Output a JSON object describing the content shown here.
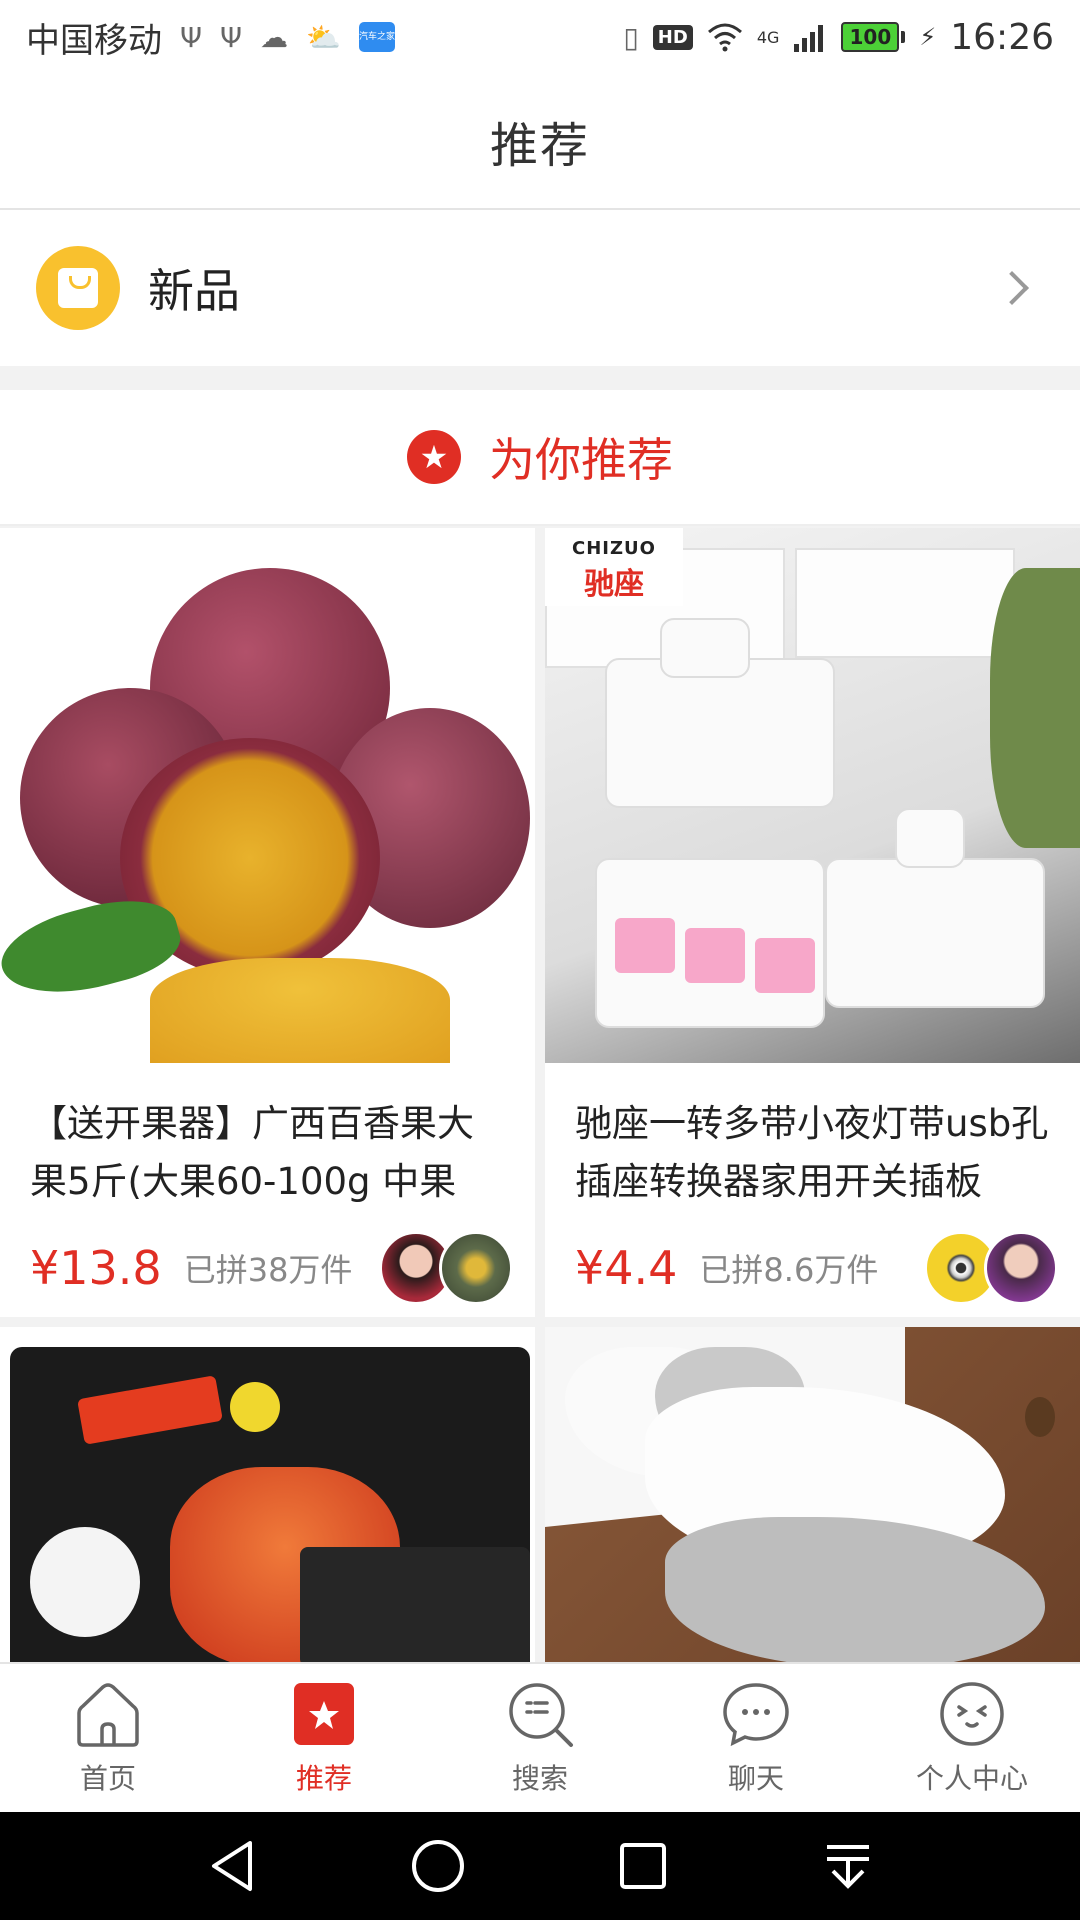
{
  "status_bar": {
    "carrier": "中国移动",
    "hd_badge": "HD",
    "network": "4G",
    "battery": "100",
    "time": "16:26",
    "app_icon_text": "汽车之家"
  },
  "header": {
    "title": "推荐"
  },
  "new_products": {
    "label": "新品",
    "accent": "#f9c12e"
  },
  "recommend": {
    "title": "为你推荐",
    "accent": "#e02e24"
  },
  "products": [
    {
      "title": "【送开果器】广西百香果大果5斤(大果60-100g 中果",
      "price": "¥13.8",
      "sold": "已拼38万件"
    },
    {
      "title": "驰座一转多带小夜灯带usb孔插座转换器家用开关插板",
      "price": "¥4.4",
      "sold": "已拼8.6万件",
      "brand_en": "CHIZUO",
      "brand_cn": "驰座"
    },
    {
      "title": "",
      "price": "",
      "sold": ""
    },
    {
      "title": "",
      "price": "",
      "sold": ""
    }
  ],
  "tabs": [
    {
      "label": "首页",
      "icon": "home-icon",
      "active": false
    },
    {
      "label": "推荐",
      "icon": "recommend-icon",
      "active": true
    },
    {
      "label": "搜索",
      "icon": "search-icon",
      "active": false
    },
    {
      "label": "聊天",
      "icon": "chat-icon",
      "active": false
    },
    {
      "label": "个人中心",
      "icon": "profile-icon",
      "active": false
    }
  ],
  "nav": [
    "back-icon",
    "home-circle-icon",
    "recents-icon",
    "notification-pull-icon"
  ]
}
